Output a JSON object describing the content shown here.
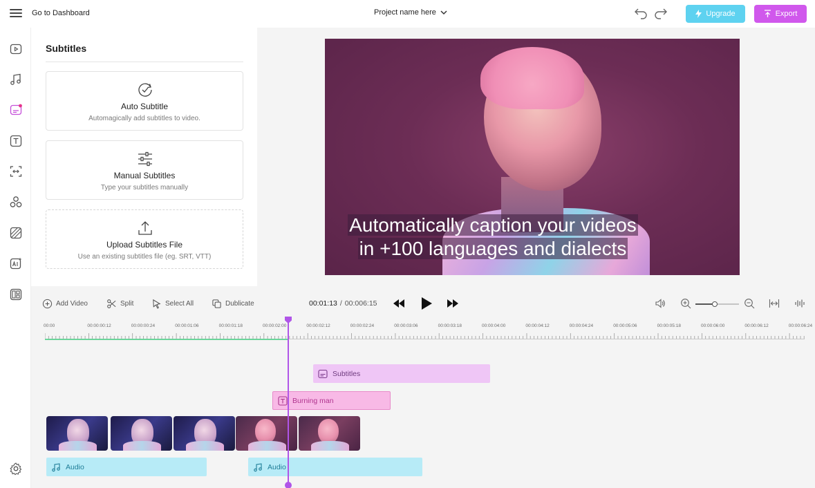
{
  "header": {
    "goto_label": "Go to Dashboard",
    "project_name": "Project name here",
    "upgrade_label": "Upgrade",
    "export_label": "Export",
    "colors": {
      "upgrade": "#5ed2f0",
      "export": "#d058ec"
    }
  },
  "rail": {
    "icons": [
      "video-icon",
      "music-icon",
      "subtitles-icon",
      "text-icon",
      "transition-icon",
      "elements-icon",
      "filters-icon",
      "ai-icon",
      "templates-icon"
    ],
    "settings_icon": "gear-icon"
  },
  "panel": {
    "title": "Subtitles",
    "cards": [
      {
        "title": "Auto Subtitle",
        "subtitle": "Automagically add subtitles to video.",
        "icon": "auto-subtitle-icon"
      },
      {
        "title": "Manual Subtitles",
        "subtitle": "Type your subtitles manually",
        "icon": "sliders-icon"
      },
      {
        "title": "Upload Subtitles File",
        "subtitle": "Use an existing subtitles file (eg. SRT, VTT)",
        "icon": "upload-icon"
      }
    ]
  },
  "preview": {
    "caption_line1": "Automatically caption your videos",
    "caption_line2": "in +100 languages and dialects"
  },
  "timeline": {
    "tools": {
      "add_video": "Add Video",
      "split": "Split",
      "select_all": "Select All",
      "duplicate": "Dublicate"
    },
    "current_time": "00:01:13",
    "separator": "/",
    "total_time": "00:006:15",
    "zoom_level": 0.45,
    "ruler_labels": [
      "00:00",
      "00:00:00:12",
      "00:00:00:24",
      "00:00:01:06",
      "00:00:01:18",
      "00:00:02:00",
      "00:00:02:12",
      "00:00:02:24",
      "00:00:03:06",
      "00:00:03:18",
      "00:00:04:00",
      "00:00:04:12",
      "00:00:04:24",
      "00:00:05:06",
      "00:00:05:18",
      "00:00:06:00",
      "00:00:06:12",
      "00:00:06:24"
    ],
    "clips": {
      "subtitles": "Subtitles",
      "text": "Burning man",
      "audio1": "Audio",
      "audio2": "Audio"
    },
    "colors": {
      "playhead": "#b055e8",
      "subtitle_clip": "#efc6f6",
      "text_clip": "#f8b9e6",
      "audio_clip": "#b7ebf7",
      "played_bar": "#6ad49a"
    }
  }
}
